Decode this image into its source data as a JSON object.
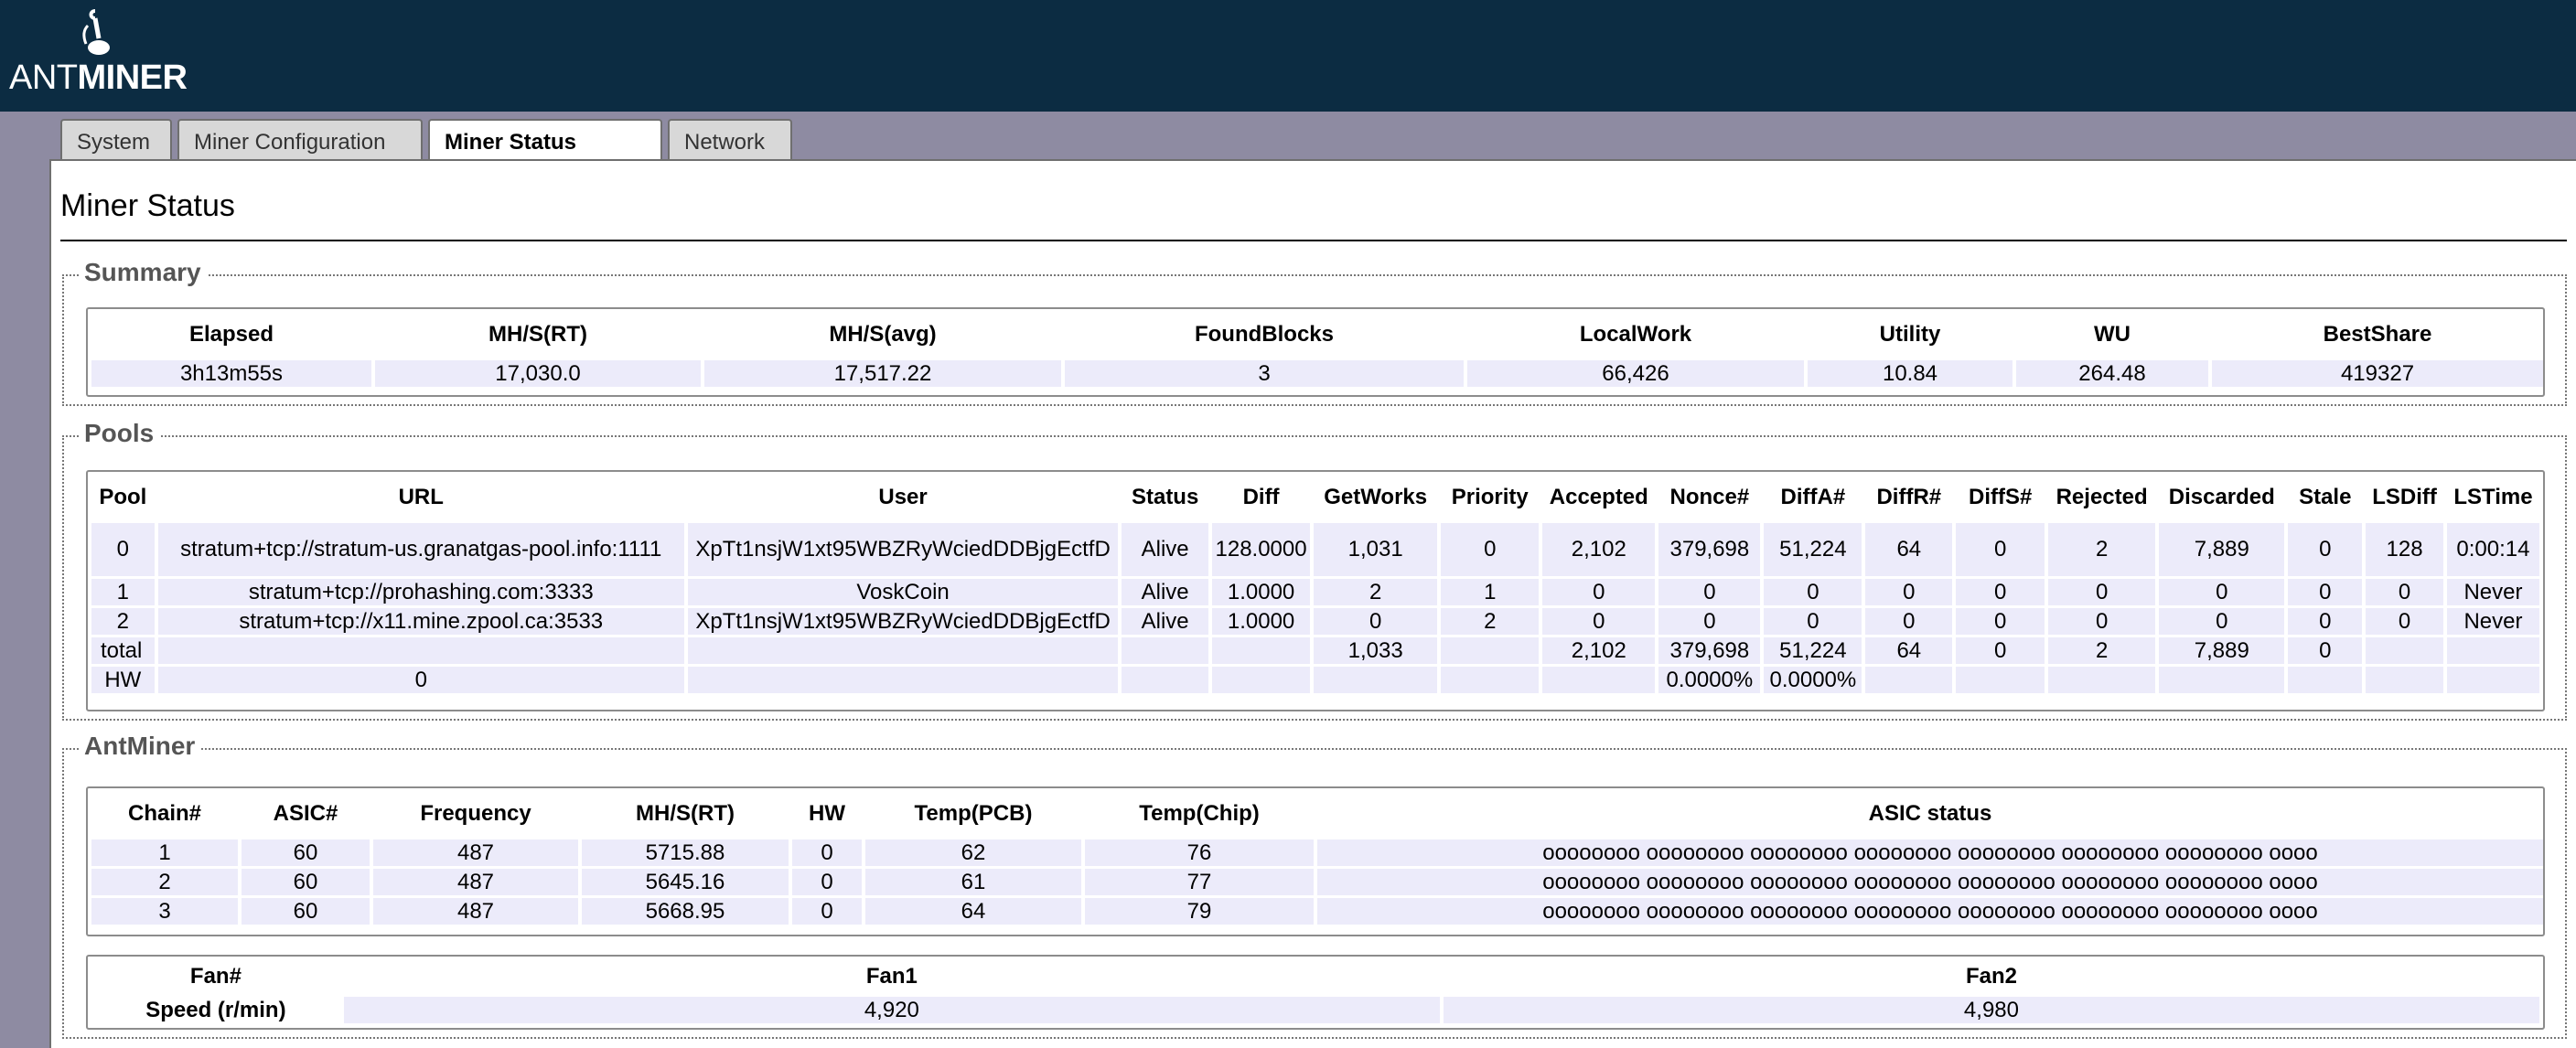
{
  "brand": {
    "ant": "ANT",
    "miner": "MINER"
  },
  "tabs": [
    {
      "label": "System",
      "active": false
    },
    {
      "label": "Miner Configuration",
      "active": false
    },
    {
      "label": "Miner Status",
      "active": true
    },
    {
      "label": "Network",
      "active": false
    }
  ],
  "page_title": "Miner Status",
  "summary": {
    "legend": "Summary",
    "headers": [
      "Elapsed",
      "MH/S(RT)",
      "MH/S(avg)",
      "FoundBlocks",
      "LocalWork",
      "Utility",
      "WU",
      "BestShare"
    ],
    "row": [
      "3h13m55s",
      "17,030.0",
      "17,517.22",
      "3",
      "66,426",
      "10.84",
      "264.48",
      "419327"
    ]
  },
  "pools": {
    "legend": "Pools",
    "headers": [
      "Pool",
      "URL",
      "User",
      "Status",
      "Diff",
      "GetWorks",
      "Priority",
      "Accepted",
      "Nonce#",
      "DiffA#",
      "DiffR#",
      "DiffS#",
      "Rejected",
      "Discarded",
      "Stale",
      "LSDiff",
      "LSTime"
    ],
    "rows": [
      [
        "0",
        "stratum+tcp://stratum-us.granatgas-pool.info:1111",
        "XpTt1nsjW1xt95WBZRyWciedDDBjgEctfD",
        "Alive",
        "128.0000",
        "1,031",
        "0",
        "2,102",
        "379,698",
        "51,224",
        "64",
        "0",
        "2",
        "7,889",
        "0",
        "128",
        "0:00:14"
      ],
      [
        "1",
        "stratum+tcp://prohashing.com:3333",
        "VoskCoin",
        "Alive",
        "1.0000",
        "2",
        "1",
        "0",
        "0",
        "0",
        "0",
        "0",
        "0",
        "0",
        "0",
        "0",
        "Never"
      ],
      [
        "2",
        "stratum+tcp://x11.mine.zpool.ca:3533",
        "XpTt1nsjW1xt95WBZRyWciedDDBjgEctfD",
        "Alive",
        "1.0000",
        "0",
        "2",
        "0",
        "0",
        "0",
        "0",
        "0",
        "0",
        "0",
        "0",
        "0",
        "Never"
      ],
      [
        "total",
        "",
        "",
        "",
        "",
        "1,033",
        "",
        "2,102",
        "379,698",
        "51,224",
        "64",
        "0",
        "2",
        "7,889",
        "0",
        "",
        ""
      ],
      [
        "HW",
        "0",
        "",
        "",
        "",
        "",
        "",
        "",
        "0.0000%",
        "0.0000%",
        "",
        "",
        "",
        "",
        "",
        "",
        ""
      ]
    ]
  },
  "antminer": {
    "legend": "AntMiner",
    "headers": [
      "Chain#",
      "ASIC#",
      "Frequency",
      "MH/S(RT)",
      "HW",
      "Temp(PCB)",
      "Temp(Chip)",
      "ASIC status"
    ],
    "rows": [
      [
        "1",
        "60",
        "487",
        "5715.88",
        "0",
        "62",
        "76",
        "oooooooo oooooooo oooooooo oooooooo oooooooo oooooooo oooooooo oooo"
      ],
      [
        "2",
        "60",
        "487",
        "5645.16",
        "0",
        "61",
        "77",
        "oooooooo oooooooo oooooooo oooooooo oooooooo oooooooo oooooooo oooo"
      ],
      [
        "3",
        "60",
        "487",
        "5668.95",
        "0",
        "64",
        "79",
        "oooooooo oooooooo oooooooo oooooooo oooooooo oooooooo oooooooo oooo"
      ]
    ],
    "fans": {
      "headers": [
        "Fan#",
        "Fan1",
        "Fan2"
      ],
      "row": [
        "Speed (r/min)",
        "4,920",
        "4,980"
      ]
    }
  }
}
